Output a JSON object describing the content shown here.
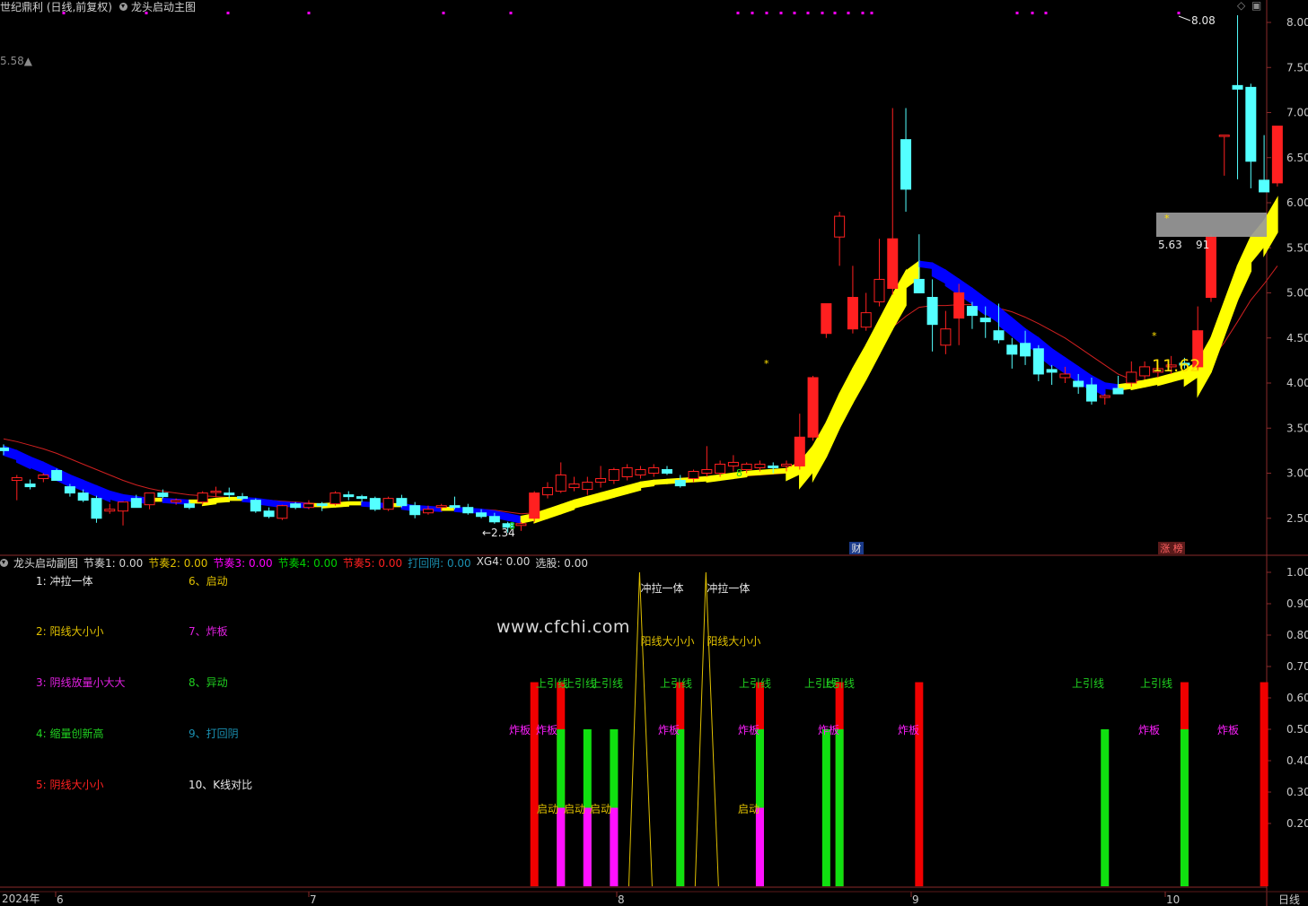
{
  "header": {
    "stock_title": "世纪鼎利 (日线,前复权)",
    "indicator_name": "龙头启动主图"
  },
  "main": {
    "left_value": "5.58▲",
    "y_ticks": [
      "8.00",
      "7.50",
      "7.00",
      "6.50",
      "6.00",
      "5.50",
      "5.00",
      "4.50",
      "4.00",
      "3.50",
      "3.00",
      "2.50"
    ],
    "high_label": "8.08",
    "low_label": "←2.34",
    "box_label_left": "5.63",
    "box_label_right": "91",
    "big_value": "11.62",
    "marker_finance": "财",
    "marker_limit": "涨 榜",
    "dot_color": "#ff00ff",
    "up_color": "#ff2020",
    "down_color": "#54ffff",
    "ribbon_yellow": "#ffff00",
    "ribbon_blue": "#0000ff"
  },
  "sub": {
    "title": "龙头启动副图",
    "items": [
      {
        "label": "节奏1: 0.00",
        "color": "#d8d8d8"
      },
      {
        "label": "节奏2: 0.00",
        "color": "#e0c000"
      },
      {
        "label": "节奏3: 0.00",
        "color": "#ff00ff"
      },
      {
        "label": "节奏4: 0.00",
        "color": "#00d000"
      },
      {
        "label": "节奏5: 0.00",
        "color": "#ff2020"
      },
      {
        "label": "打回阴: 0.00",
        "color": "#1a8fb0"
      },
      {
        "label": "XG4: 0.00",
        "color": "#d8d8d8"
      },
      {
        "label": "选股: 0.00",
        "color": "#d8d8d8"
      }
    ],
    "y_ticks": [
      "1.00",
      "0.90",
      "0.80",
      "0.70",
      "0.60",
      "0.50",
      "0.40",
      "0.30",
      "0.20"
    ],
    "legend": [
      {
        "text": "1:  冲拉一体",
        "color": "#e8e8e8"
      },
      {
        "text": "2:  阳线大小小",
        "color": "#e0c000"
      },
      {
        "text": "3:  阴线放量小大大",
        "color": "#e020e0"
      },
      {
        "text": "4:  缩量创新高",
        "color": "#20d020"
      },
      {
        "text": "5:  阴线大小小",
        "color": "#ff2020"
      },
      {
        "text": "6、启动",
        "color": "#e0c000"
      },
      {
        "text": "7、炸板",
        "color": "#e020e0"
      },
      {
        "text": "8、异动",
        "color": "#20d020"
      },
      {
        "text": "9、打回阴",
        "color": "#1a8fb0"
      },
      {
        "text": "10、K线对比",
        "color": "#e8e8e8"
      }
    ],
    "label_chongla": "冲拉一体",
    "label_yangxian": "阳线大小小",
    "label_shangyinxian": "上引线",
    "label_zhaban": "炸板",
    "label_qidong": "启动"
  },
  "xaxis": {
    "year_label": "2024年",
    "months": [
      "6",
      "7",
      "8",
      "9",
      "10"
    ],
    "period": "日线"
  },
  "watermark": "www.cfchi.com",
  "chart_data": {
    "type": "candlestick",
    "ylim": [
      2.2,
      8.25
    ],
    "y_ticks": [
      2.5,
      3.0,
      3.5,
      4.0,
      4.5,
      5.0,
      5.5,
      6.0,
      6.5,
      7.0,
      7.5,
      8.0
    ],
    "candles": [
      [
        3.28,
        3.32,
        3.2,
        3.25
      ],
      [
        2.92,
        2.98,
        2.7,
        2.95
      ],
      [
        2.88,
        2.93,
        2.82,
        2.85
      ],
      [
        2.94,
        3.0,
        2.9,
        2.98
      ],
      [
        3.03,
        3.05,
        2.92,
        2.92
      ],
      [
        2.85,
        2.88,
        2.74,
        2.78
      ],
      [
        2.78,
        2.82,
        2.68,
        2.7
      ],
      [
        2.72,
        2.75,
        2.45,
        2.5
      ],
      [
        2.58,
        2.66,
        2.55,
        2.6
      ],
      [
        2.58,
        2.68,
        2.42,
        2.68
      ],
      [
        2.72,
        2.76,
        2.62,
        2.62
      ],
      [
        2.65,
        2.78,
        2.6,
        2.78
      ],
      [
        2.78,
        2.82,
        2.72,
        2.74
      ],
      [
        2.68,
        2.72,
        2.65,
        2.7
      ],
      [
        2.66,
        2.7,
        2.6,
        2.62
      ],
      [
        2.68,
        2.8,
        2.65,
        2.78
      ],
      [
        2.8,
        2.85,
        2.74,
        2.8
      ],
      [
        2.78,
        2.84,
        2.72,
        2.76
      ],
      [
        2.74,
        2.78,
        2.7,
        2.72
      ],
      [
        2.7,
        2.72,
        2.56,
        2.58
      ],
      [
        2.58,
        2.62,
        2.5,
        2.52
      ],
      [
        2.5,
        2.65,
        2.48,
        2.64
      ],
      [
        2.66,
        2.68,
        2.6,
        2.62
      ],
      [
        2.62,
        2.7,
        2.6,
        2.66
      ],
      [
        2.66,
        2.68,
        2.58,
        2.64
      ],
      [
        2.66,
        2.8,
        2.64,
        2.78
      ],
      [
        2.76,
        2.8,
        2.7,
        2.74
      ],
      [
        2.74,
        2.76,
        2.68,
        2.72
      ],
      [
        2.72,
        2.74,
        2.58,
        2.6
      ],
      [
        2.6,
        2.74,
        2.58,
        2.72
      ],
      [
        2.72,
        2.76,
        2.62,
        2.64
      ],
      [
        2.64,
        2.68,
        2.5,
        2.54
      ],
      [
        2.56,
        2.64,
        2.54,
        2.6
      ],
      [
        2.62,
        2.66,
        2.58,
        2.64
      ],
      [
        2.64,
        2.74,
        2.6,
        2.62
      ],
      [
        2.62,
        2.66,
        2.54,
        2.56
      ],
      [
        2.56,
        2.6,
        2.5,
        2.52
      ],
      [
        2.52,
        2.56,
        2.44,
        2.46
      ],
      [
        2.44,
        2.46,
        2.34,
        2.4
      ],
      [
        2.42,
        2.46,
        2.36,
        2.44
      ],
      [
        2.5,
        2.8,
        2.46,
        2.78
      ],
      [
        2.76,
        2.9,
        2.72,
        2.84
      ],
      [
        2.8,
        3.12,
        2.78,
        2.98
      ],
      [
        2.84,
        2.96,
        2.8,
        2.88
      ],
      [
        2.82,
        2.96,
        2.76,
        2.9
      ],
      [
        2.9,
        3.08,
        2.84,
        2.94
      ],
      [
        2.92,
        3.06,
        2.88,
        3.04
      ],
      [
        2.96,
        3.1,
        2.92,
        3.06
      ],
      [
        2.98,
        3.08,
        2.94,
        3.04
      ],
      [
        3.0,
        3.1,
        2.96,
        3.06
      ],
      [
        3.04,
        3.08,
        2.98,
        3.0
      ],
      [
        2.92,
        2.98,
        2.84,
        2.86
      ],
      [
        2.94,
        3.04,
        2.9,
        3.02
      ],
      [
        3.0,
        3.3,
        2.96,
        3.04
      ],
      [
        3.0,
        3.14,
        2.96,
        3.1
      ],
      [
        3.08,
        3.2,
        3.02,
        3.12
      ],
      [
        3.04,
        3.12,
        3.0,
        3.1
      ],
      [
        3.06,
        3.14,
        3.02,
        3.1
      ],
      [
        3.08,
        3.12,
        3.0,
        3.06
      ],
      [
        3.08,
        3.14,
        3.02,
        3.1
      ],
      [
        3.08,
        3.66,
        3.04,
        3.4
      ],
      [
        3.4,
        4.08,
        3.36,
        4.06
      ],
      [
        4.55,
        4.88,
        4.5,
        4.88
      ],
      [
        5.62,
        5.9,
        5.3,
        5.85
      ],
      [
        4.6,
        5.3,
        4.55,
        4.95
      ],
      [
        4.62,
        5.0,
        4.58,
        4.78
      ],
      [
        4.9,
        5.6,
        4.85,
        5.15
      ],
      [
        5.05,
        7.05,
        4.98,
        5.6
      ],
      [
        6.7,
        7.05,
        5.9,
        6.15
      ],
      [
        5.15,
        5.65,
        5.05,
        5.0
      ],
      [
        4.95,
        5.15,
        4.35,
        4.65
      ],
      [
        4.42,
        4.8,
        4.32,
        4.6
      ],
      [
        4.72,
        5.1,
        4.42,
        5.0
      ],
      [
        4.85,
        4.9,
        4.6,
        4.75
      ],
      [
        4.72,
        4.85,
        4.5,
        4.68
      ],
      [
        4.58,
        4.88,
        4.44,
        4.48
      ],
      [
        4.42,
        4.5,
        4.16,
        4.32
      ],
      [
        4.44,
        4.58,
        4.2,
        4.3
      ],
      [
        4.38,
        4.42,
        4.02,
        4.1
      ],
      [
        4.15,
        4.2,
        3.98,
        4.12
      ],
      [
        4.06,
        4.18,
        4.0,
        4.1
      ],
      [
        4.02,
        4.1,
        3.88,
        3.96
      ],
      [
        3.98,
        4.06,
        3.76,
        3.8
      ],
      [
        3.84,
        3.88,
        3.76,
        3.86
      ],
      [
        3.94,
        4.08,
        3.88,
        3.88
      ],
      [
        4.0,
        4.24,
        3.96,
        4.12
      ],
      [
        4.08,
        4.24,
        4.04,
        4.18
      ],
      [
        4.12,
        4.2,
        4.06,
        4.16
      ],
      [
        4.18,
        4.3,
        4.1,
        4.2
      ],
      [
        4.22,
        4.28,
        4.16,
        4.2
      ],
      [
        4.18,
        4.85,
        4.14,
        4.58
      ],
      [
        4.95,
        5.65,
        4.9,
        5.62
      ],
      [
        6.75,
        6.75,
        6.3,
        6.75
      ],
      [
        7.3,
        8.08,
        6.26,
        7.26
      ],
      [
        7.28,
        7.32,
        6.16,
        6.46
      ],
      [
        6.25,
        6.75,
        6.15,
        6.12
      ],
      [
        6.22,
        6.85,
        6.18,
        6.85
      ]
    ],
    "ma_fast": [
      3.3,
      3.25,
      3.18,
      3.12,
      3.05,
      2.98,
      2.92,
      2.86,
      2.8,
      2.76,
      2.74,
      2.72,
      2.72,
      2.71,
      2.7,
      2.7,
      2.72,
      2.73,
      2.73,
      2.72,
      2.7,
      2.68,
      2.67,
      2.66,
      2.66,
      2.67,
      2.68,
      2.68,
      2.67,
      2.66,
      2.66,
      2.64,
      2.63,
      2.62,
      2.62,
      2.61,
      2.6,
      2.58,
      2.55,
      2.52,
      2.55,
      2.6,
      2.65,
      2.7,
      2.74,
      2.78,
      2.82,
      2.86,
      2.9,
      2.92,
      2.93,
      2.94,
      2.95,
      2.96,
      2.98,
      3.0,
      3.02,
      3.03,
      3.04,
      3.05,
      3.12,
      3.3,
      3.56,
      3.88,
      4.16,
      4.42,
      4.7,
      4.98,
      5.24,
      5.35,
      5.33,
      5.25,
      5.15,
      5.05,
      4.94,
      4.84,
      4.72,
      4.6,
      4.5,
      4.38,
      4.28,
      4.18,
      4.08,
      4.0,
      3.98,
      4.0,
      4.03,
      4.06,
      4.1,
      4.14,
      4.24,
      4.5,
      4.9,
      5.3,
      5.62,
      5.8,
      6.05
    ],
    "ma_slow": [
      3.38,
      3.35,
      3.31,
      3.27,
      3.22,
      3.16,
      3.1,
      3.04,
      2.98,
      2.92,
      2.87,
      2.83,
      2.8,
      2.78,
      2.76,
      2.75,
      2.74,
      2.73,
      2.72,
      2.71,
      2.7,
      2.69,
      2.68,
      2.67,
      2.66,
      2.66,
      2.66,
      2.66,
      2.66,
      2.65,
      2.65,
      2.64,
      2.63,
      2.62,
      2.62,
      2.61,
      2.6,
      2.59,
      2.57,
      2.55,
      2.56,
      2.6,
      2.64,
      2.68,
      2.71,
      2.75,
      2.78,
      2.81,
      2.84,
      2.87,
      2.9,
      2.91,
      2.92,
      2.93,
      2.94,
      2.96,
      2.97,
      2.98,
      2.99,
      3.0,
      3.05,
      3.2,
      3.42,
      3.7,
      4.0,
      4.25,
      4.45,
      4.62,
      4.74,
      4.84,
      4.86,
      4.86,
      4.87,
      4.87,
      4.86,
      4.83,
      4.79,
      4.73,
      4.66,
      4.58,
      4.5,
      4.4,
      4.3,
      4.2,
      4.1,
      4.04,
      4.02,
      4.02,
      4.04,
      4.08,
      4.14,
      4.26,
      4.45,
      4.68,
      4.92,
      5.1,
      5.3
    ],
    "sub_bars": [
      {
        "i": 40,
        "type": "red",
        "v": 0.65
      },
      {
        "i": 42,
        "type": "red",
        "v": 0.65
      },
      {
        "i": 42,
        "type": "green",
        "v": 0.5
      },
      {
        "i": 42,
        "type": "magenta",
        "v": 0.25
      },
      {
        "i": 44,
        "type": "green",
        "v": 0.5
      },
      {
        "i": 44,
        "type": "magenta",
        "v": 0.25
      },
      {
        "i": 46,
        "type": "green",
        "v": 0.5
      },
      {
        "i": 46,
        "type": "magenta",
        "v": 0.25
      },
      {
        "i": 51,
        "type": "red",
        "v": 0.65
      },
      {
        "i": 51,
        "type": "green",
        "v": 0.5
      },
      {
        "i": 57,
        "type": "red",
        "v": 0.65
      },
      {
        "i": 57,
        "type": "green",
        "v": 0.5
      },
      {
        "i": 57,
        "type": "magenta",
        "v": 0.25
      },
      {
        "i": 62,
        "type": "green",
        "v": 0.5
      },
      {
        "i": 63,
        "type": "red",
        "v": 0.65
      },
      {
        "i": 63,
        "type": "green",
        "v": 0.5
      },
      {
        "i": 69,
        "type": "red",
        "v": 0.65
      },
      {
        "i": 83,
        "type": "green",
        "v": 0.5
      },
      {
        "i": 89,
        "type": "red",
        "v": 0.65
      },
      {
        "i": 89,
        "type": "green",
        "v": 0.5
      },
      {
        "i": 95,
        "type": "red",
        "v": 0.65
      }
    ],
    "sub_spikes": [
      48,
      53
    ],
    "sub_ylim": [
      0,
      1.0
    ]
  }
}
